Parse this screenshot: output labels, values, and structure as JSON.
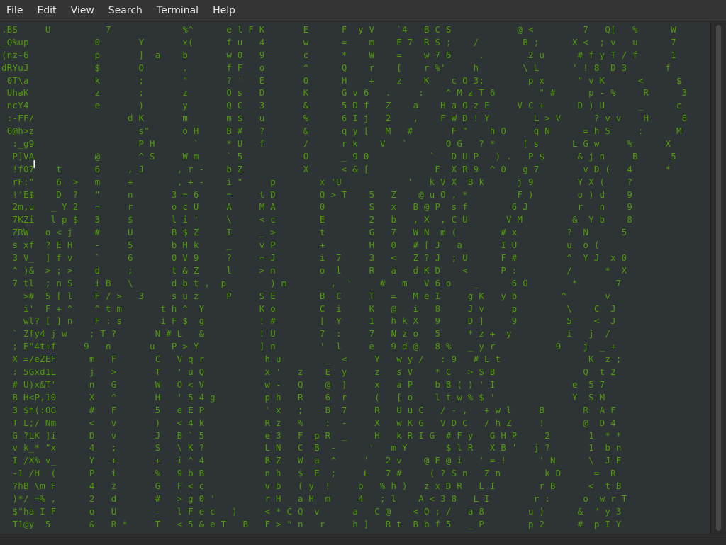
{
  "menubar": {
    "items": [
      "File",
      "Edit",
      "View",
      "Search",
      "Terminal",
      "Help"
    ]
  },
  "colors": {
    "terminal_background": "#2e3436",
    "matrix_green": "#4e9a06",
    "highlight_white": "#ffffff",
    "menubar_background": "#353535"
  },
  "terminal": {
    "lines": [
      ".BS     U          7             %^      e l F K       E      F  y V    `4   B C S            @ <         7   Q[   %      W",
      "_Q%up            0       Y       x(      f u   4       w      =    m    E 7  R S ;    /        B ;      X <  ; v   u      7",
      "(nz-6            p       ]  a    b       w 0   9       c      *    W    =    w 7 6     .        2 u      # f y T / f      1",
      "dRYuJ            $       O       .       f F   o       ^      Q    r    [    r %'     h        \\ L      ' ! 8  D 3       f",
      " 0T\\a            k       ;       \"       ? '   E       0      H    +    z    K    c O 3;        p x      \" v K      <      $",
      " UhaK            z       ;       z       Q s   D       K      G v 6   .     :    ^ M z T 6        \" #      p - %     R      3",
      " ncY4            e       )       y       Q C   3       &      5 D f   Z    a    H a O z E     V C +      D ) U      _      c",
      " :-FF/                 d K       m       m $   u       %      6 I j   2    ,    F W D ! Y        L > V      ? v v    H      8",
      " 6@h>z                   s\"      o H     B #   ?       &      q y [   M   #       F \"    h O     q N      = h S     :      M",
      "  :_g9                   P H       `     * U   f       /      r k    V   `       O G   ? *     [ s      L G w     %      X",
      "  P]VA           @       ^ S     W m     ` 5           O      _ 9 0           `   D U P   ) .   P $      & j n     B      5",
      "  !f07    t      6     , J      , r -    b Z           X      < & [            E  X R 9  ^ 0   g 7        v D (   4      *",
      "  rF:\"    6  >   m     +        , + -    i \"     p        x 'U            '   k V X  B k      j 9        Y X (    ?",
      "  !'E$    D  ?   \"     n       3 = 6     =     t D        Q > T    5   Z    @ u O , *         F )        o ) d    9",
      "  2m,u   _ Y 2   =     r       o c U     A     M A        0        S   x   B @ P  s f        6 J         r   n    9",
      "  7KZi   l p $   3     $       l i '     \\     < c        E        2   b   , X  , C U       V M         &  Y b    8",
      "  ZRW   o < j    #     U       B $ Z     I     _ >        t        G   7   W N  m (        # x         ?  N      5",
      "  s xf  ? E H    -     5       b H k     _     v P        +        H   0   # [ J   a       I U         u  o (    ",
      "  3 V_  ] f v    `     6       0 V 9     ?     = J        i  7     3   <   Z ? J  ; U      F #         ^  Y J  x 0",
      "  ^ )&  > ; >    d     ;       t & Z     l     > n        o  l     R   a   d K D    <      P :         /      *  X",
      "  7 tl  ; n S    i B   \\       d b t ,  p        ) m        ,  '     #   m   V 6 o    _      6 O        *       7",
      "    >#  5 [ l    F / >   3     s u z     P     S E        B  C     T   =   M e I     g K   y b        ^       v",
      "    i'  F + ^    ^ t m       t h ^  Y          K o        C  i     K   @   i   8     J v     p         \\    C  J",
      "    wl? [ ] n    F : s       i F $  g          ! #        [  Y     1   h k X   9     D ]     9         5    <  J",
      "  ` Zfy4 j w    ; T ?       N # L   &          ! U        7  :     7   N z o   5     * z +  y          i   j  /",
      "  ; E\"4t+f     9   n       u   P > Y           ] n        '  l     e   9 d @   8 %   _ y r           9    j  _ +",
      "  X =/eZEF      m   F       C   V q r           h u        _  <     Y   w y /   : 9   # L t                K  z ;",
      "  : 5Gxd1L      j   >       T   ' u Q           x '   z    E  y     z   s V    * C   > S B                Q  t 2",
      "  # U)x&T'      n   G       W   O < V           w -   Q    @  ]     x   a P    b B ( ) ' I              e  5 7",
      "  B H<P,10      X   ^       H   ' 5 4 g         p h   R    6  r     (   [ o    l t w % $ '              Y  S M",
      "  3 $h(:0G      #   F       5   e E P           ' x   ;    B  7     R   U u C   / - ,   + w l     B       R  A F",
      "  T L;/ Nm      <   v       )   < 4 k           R z   %    :  -     X   w K G   V D C   / h Z     !       @  D 4",
      "  G ?LK ]i      D   v       J   B ` 5           e 3   F  p R  _     H   k R I G  # F y   G H P     2       1  * *",
      "  v k_* \"x      4   ;       S   \\ K ?           L N   C  B  -      '   m Y       $ l R   X B '   j ?       1  b n",
      "  I /X% v_      Y   +       +   i ^ 4           B Z   W  a  ^     '   2 v    @ E @ i   ' = !      ' N      \\  J E",
      "  -1 /H  (      P   i       %   9 b B           n h   $  E  ;     L   7 #     ( ? S n   Z n        k D      =  R",
      "  ?hB \\m F      4   z       G   F < c           v b   ( y  !     o   % h )   z x D R   L I        r B      <  t B",
      "  )*/ =% ,      2   d       #   > g 0 '         r H   a H  m     4   ; l    A < 3 8   L I        r :      o  w r T",
      "  $\"ha I F      o   U       -   l F e c   )     < * C Q  v      a   C @    < O ; /   a 8        u )      &  \" y 3",
      "  T1@y  5       &   R *     T   < 5 & e T   B   F > \" n   r     h ]   R t  B b f 5   _ P        p 2      #  p I Y"
    ]
  }
}
